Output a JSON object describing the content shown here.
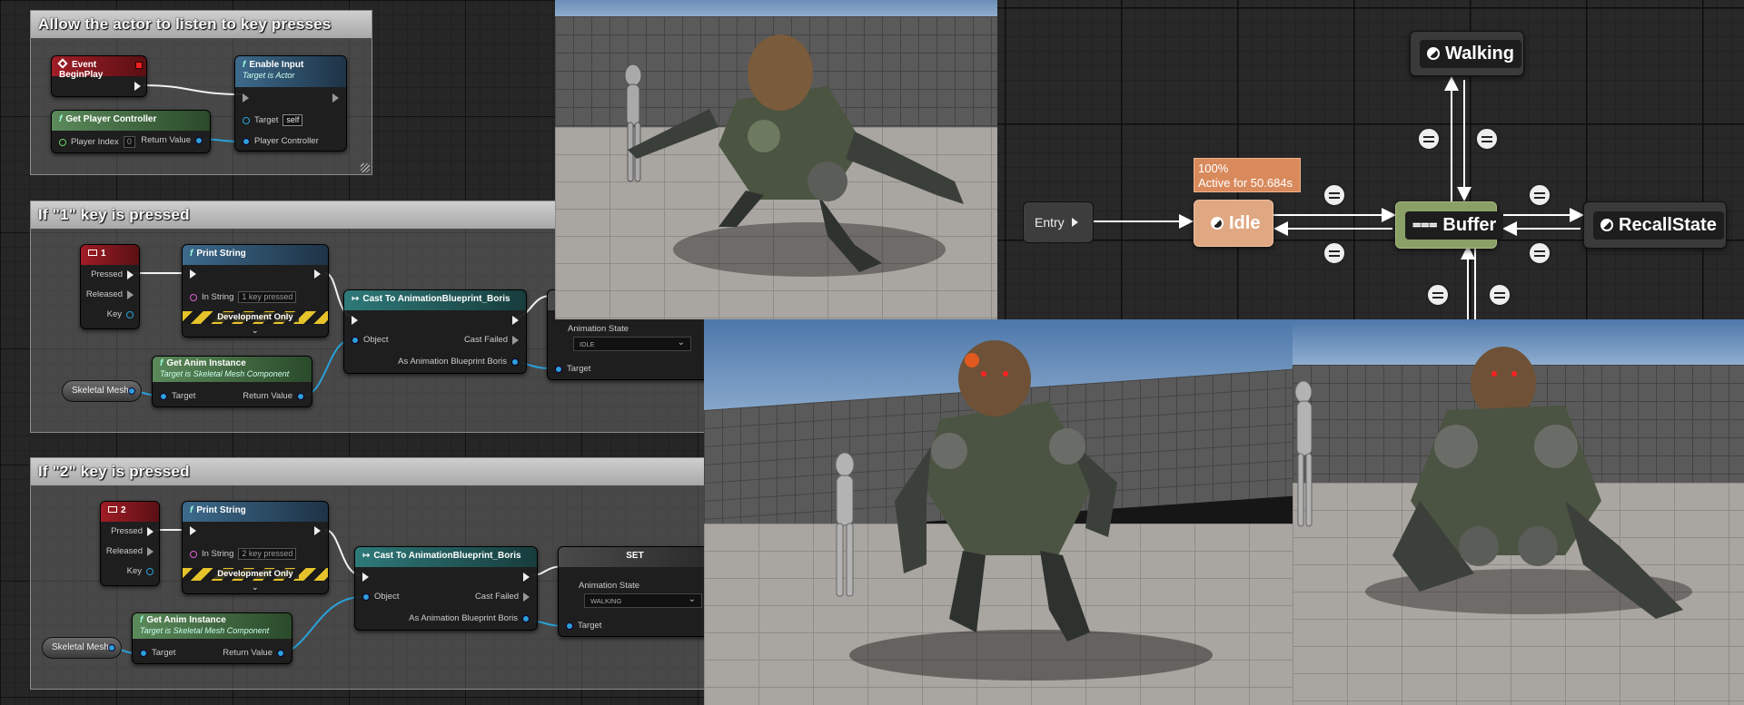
{
  "blueprint": {
    "comments": [
      {
        "title": "Allow the actor to listen to key presses"
      },
      {
        "title": "If \"1\" key is pressed"
      },
      {
        "title": "If \"2\" key is pressed"
      }
    ],
    "event_begin_play": {
      "title": "Event BeginPlay"
    },
    "enable_input": {
      "title": "Enable Input",
      "subtitle": "Target is Actor",
      "target_label": "Target",
      "target_value": "self",
      "pc_label": "Player Controller"
    },
    "get_player_controller": {
      "title": "Get Player Controller",
      "player_index_label": "Player Index",
      "player_index_value": "0",
      "return_label": "Return Value"
    },
    "key1": {
      "title": "1",
      "pressed": "Pressed",
      "released": "Released",
      "key": "Key"
    },
    "key2": {
      "title": "2",
      "pressed": "Pressed",
      "released": "Released",
      "key": "Key"
    },
    "print1": {
      "title": "Print String",
      "in_string_label": "In String",
      "in_string_value": "1 key pressed",
      "dev": "Development Only"
    },
    "print2": {
      "title": "Print String",
      "in_string_label": "In String",
      "in_string_value": "2 key pressed",
      "dev": "Development Only"
    },
    "cast1": {
      "title": "Cast To AnimationBlueprint_Boris",
      "object": "Object",
      "cast_failed": "Cast Failed",
      "as_bp": "As Animation Blueprint Boris"
    },
    "cast2": {
      "title": "Cast To AnimationBlueprint_Boris",
      "object": "Object",
      "cast_failed": "Cast Failed",
      "as_bp": "As Animation Blueprint Boris"
    },
    "anim1": {
      "title": "Get Anim Instance",
      "subtitle": "Target is Skeletal Mesh Component",
      "target": "Target",
      "return": "Return Value"
    },
    "anim2": {
      "title": "Get Anim Instance",
      "subtitle": "Target is Skeletal Mesh Component",
      "target": "Target",
      "return": "Return Value"
    },
    "skel1": "Skeletal Mesh",
    "skel2": "Skeletal Mesh",
    "set1": {
      "anim_state_label": "Animation State",
      "anim_state_value": "IDLE",
      "target": "Target"
    },
    "set2": {
      "title": "SET",
      "anim_state_label": "Animation State",
      "anim_state_value": "WALKING",
      "target": "Target"
    }
  },
  "state_machine": {
    "entry": "Entry",
    "idle": "Idle",
    "walking": "Walking",
    "buffer": "Buffer",
    "recall": "RecallState",
    "tooltip_line1": "100%",
    "tooltip_line2": "Active for 50.684s"
  }
}
